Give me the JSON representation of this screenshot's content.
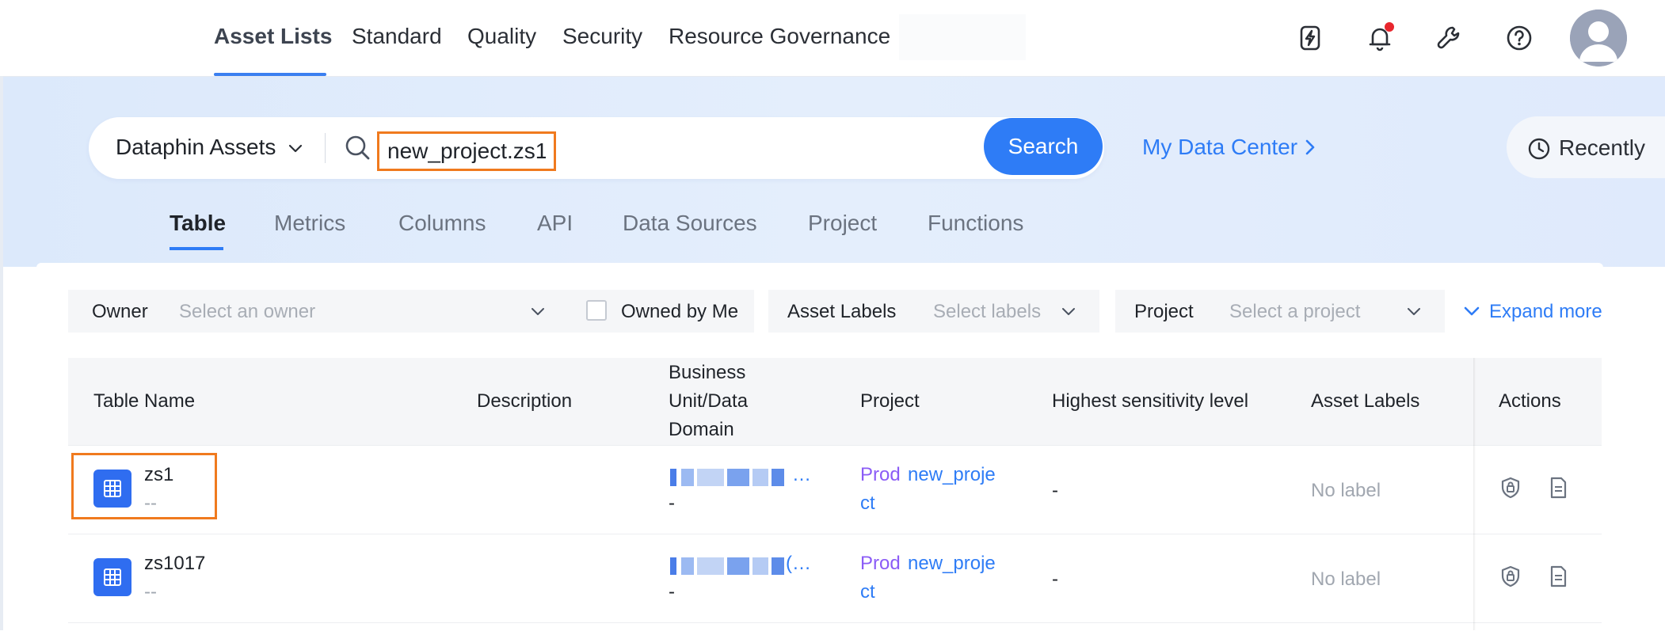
{
  "nav": {
    "tabs": [
      {
        "label": "Asset Lists",
        "active": true
      },
      {
        "label": "Standard"
      },
      {
        "label": "Quality"
      },
      {
        "label": "Security"
      },
      {
        "label": "Resource Governance"
      }
    ],
    "icons": [
      "power-icon",
      "bell-icon",
      "wrench-icon",
      "help-icon"
    ],
    "notification_dot_color": "#e8262d"
  },
  "search": {
    "scope": "Dataphin Assets",
    "query": "new_project.zs1",
    "button": "Search",
    "my_data_center": "My Data Center",
    "recently": "Recently"
  },
  "asset_tabs": [
    {
      "label": "Table",
      "active": true
    },
    {
      "label": "Metrics"
    },
    {
      "label": "Columns"
    },
    {
      "label": "API"
    },
    {
      "label": "Data Sources"
    },
    {
      "label": "Project"
    },
    {
      "label": "Functions"
    }
  ],
  "filters": {
    "owner": {
      "label": "Owner",
      "placeholder": "Select an owner"
    },
    "owned_by_me": "Owned by Me",
    "asset_labels": {
      "label": "Asset Labels",
      "placeholder": "Select labels"
    },
    "project": {
      "label": "Project",
      "placeholder": "Select a project"
    },
    "expand_more": "Expand more"
  },
  "table": {
    "columns": {
      "table_name": "Table Name",
      "description": "Description",
      "business_unit": [
        "Business",
        "Unit/Data",
        "Domain"
      ],
      "project": "Project",
      "sensitivity": "Highest sensitivity level",
      "asset_labels": "Asset Labels",
      "actions": "Actions"
    },
    "rows": [
      {
        "name": "zs1",
        "sub": "--",
        "domain_suffix": "…",
        "domain_sub": "-",
        "env": "Prod",
        "project_line1": "new_proje",
        "project_line2": "ct",
        "sensitivity": "-",
        "labels": "No label"
      },
      {
        "name": "zs1017",
        "sub": "--",
        "domain_suffix": "(…",
        "domain_sub": "-",
        "env": "Prod",
        "project_line1": "new_proje",
        "project_line2": "ct",
        "sensitivity": "-",
        "labels": "No label"
      }
    ]
  },
  "colors": {
    "accent": "#2e7cf6",
    "highlight": "#f07a1e",
    "prod": "#8b5cf6"
  }
}
